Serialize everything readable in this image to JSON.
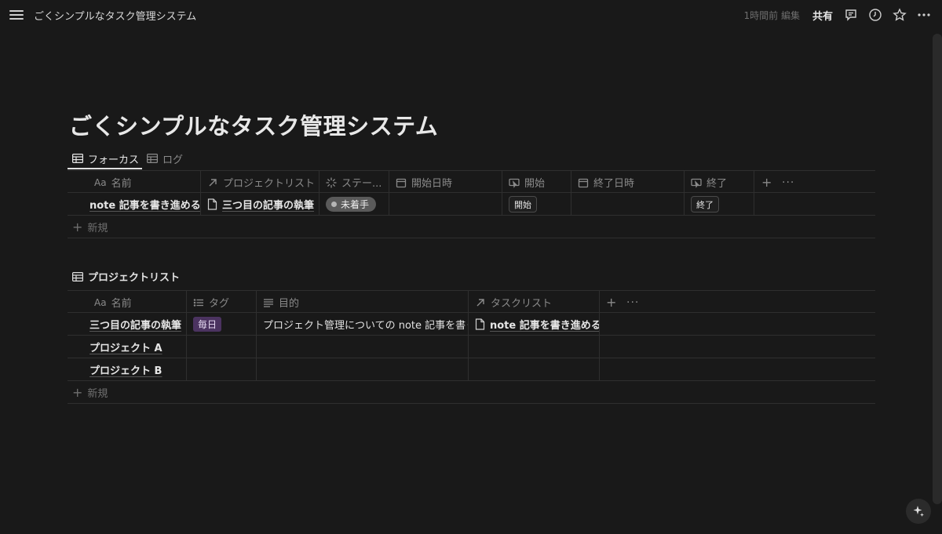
{
  "topbar": {
    "breadcrumb": "ごくシンプルなタスク管理システム",
    "edited": "1時間前 編集",
    "share_label": "共有",
    "icons": [
      "menu-icon",
      "comment-icon",
      "clock-icon",
      "star-icon",
      "more-icon"
    ]
  },
  "page": {
    "title": "ごくシンプルなタスク管理システム"
  },
  "views": {
    "tabs": [
      {
        "label": "フォーカス",
        "active": true
      },
      {
        "label": "ログ",
        "active": false
      }
    ]
  },
  "task_table": {
    "headers": {
      "aa": "Aa",
      "name": "名前",
      "project": "プロジェクトリスト",
      "status": "ステー...",
      "start_date": "開始日時",
      "start": "開始",
      "end_date": "終了日時",
      "end": "終了"
    },
    "rows": [
      {
        "name": "note 記事を書き進める",
        "project": "三つ目の記事の執筆",
        "status": "未着手",
        "start_date": "",
        "start_button": "開始",
        "end_date": "",
        "end_button": "終了"
      }
    ],
    "new_label": "新規"
  },
  "project_section": {
    "title": "プロジェクトリスト"
  },
  "project_table": {
    "headers": {
      "aa": "Aa",
      "name": "名前",
      "tag": "タグ",
      "goal": "目的",
      "tasks": "タスクリスト"
    },
    "rows": [
      {
        "name": "三つ目の記事の執筆",
        "tag": "毎日",
        "goal": "プロジェクト管理についての note 記事を書く",
        "tasks": "note 記事を書き進める"
      },
      {
        "name": "プロジェクト A",
        "tag": "",
        "goal": "",
        "tasks": ""
      },
      {
        "name": "プロジェクト B",
        "tag": "",
        "goal": "",
        "tasks": ""
      }
    ],
    "new_label": "新規"
  },
  "colors": {
    "background": "#191919",
    "tag_daily": "#4b3360",
    "status_pill": "#5a5a5a"
  }
}
